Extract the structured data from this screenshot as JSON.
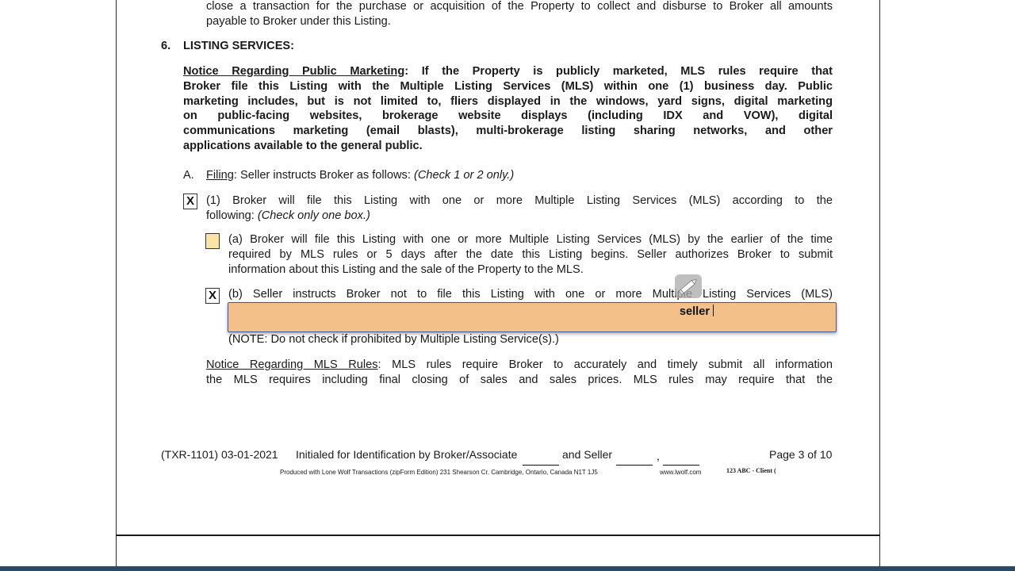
{
  "doc": {
    "top_lines": [
      "close a transaction for the purchase or acquisition of the Property to collect and disburse to Broker all amounts",
      "payable to Broker under this Listing."
    ],
    "section_number": "6.",
    "section_title": "LISTING SERVICES:",
    "notice_public": {
      "heading": "Notice Regarding Public Marketing",
      "lines": [
        ": If the Property is publicly marketed, MLS rules require that",
        "Broker file this Listing with the Multiple Listing Services (MLS) within one (1) business day. Public",
        "marketing includes, but is not limited to, fliers displayed in the windows, yard signs, digital marketing",
        "on public-facing websites, brokerage website displays (including IDX and VOW), digital",
        "communications marketing (email blasts), multi-brokerage listing sharing networks, and other",
        "applications available to the general public."
      ]
    },
    "filing": {
      "letter": "A.",
      "label": "Filing",
      "text": ": Seller instructs Broker as follows: ",
      "hint": "(Check 1 or 2 only.)"
    },
    "option1": {
      "mark": "X",
      "line1": "(1) Broker will file this Listing with one or more Multiple Listing Services (MLS) according to the",
      "line2": "following: ",
      "hint": "(Check only one box.)"
    },
    "option_a": {
      "mark": "",
      "lines": [
        "(a) Broker will file this Listing with one or more Multiple Listing Services (MLS) by the earlier of the time",
        "required by MLS rules or 5 days after the date this Listing begins. Seller authorizes Broker to submit",
        "information about this Listing and the sale of the Property to the MLS."
      ]
    },
    "option_b": {
      "mark": "X",
      "line1": "(b) Seller instructs Broker not to file this Listing with one or more Multiple Listing Services (MLS)",
      "note": "(NOTE: Do not check if prohibited by Multiple Listing Service(s).)"
    },
    "notice_mls": {
      "heading": "Notice Regarding MLS Rules",
      "lines": [
        ": MLS rules require Broker to accurately and timely submit all information",
        "the MLS requires including final closing of sales and sales prices. MLS rules may require that the"
      ]
    },
    "footer": {
      "form_id": "(TXR-1101) 03-01-2021",
      "initialed": "Initialed for Identification by Broker/Associate",
      "and_seller": "and Seller",
      "comma": ",",
      "page": "Page 3 of 10",
      "produced": "Produced with Lone Wolf Transactions (zipForm Edition) 231 Shearson Cr. Cambridge, Ontario, Canada N1T 1J5",
      "website": "www.lwolf.com",
      "client": "123 ABC - Client ("
    }
  },
  "field": {
    "value": "seller",
    "edit_icon": "pencil-icon"
  },
  "colors": {
    "field_fill": "#f4c08a",
    "field_border": "#3b5aa0",
    "empty_checkbox": "#fbe3a8",
    "bottom_bar": "#2b4a66"
  }
}
